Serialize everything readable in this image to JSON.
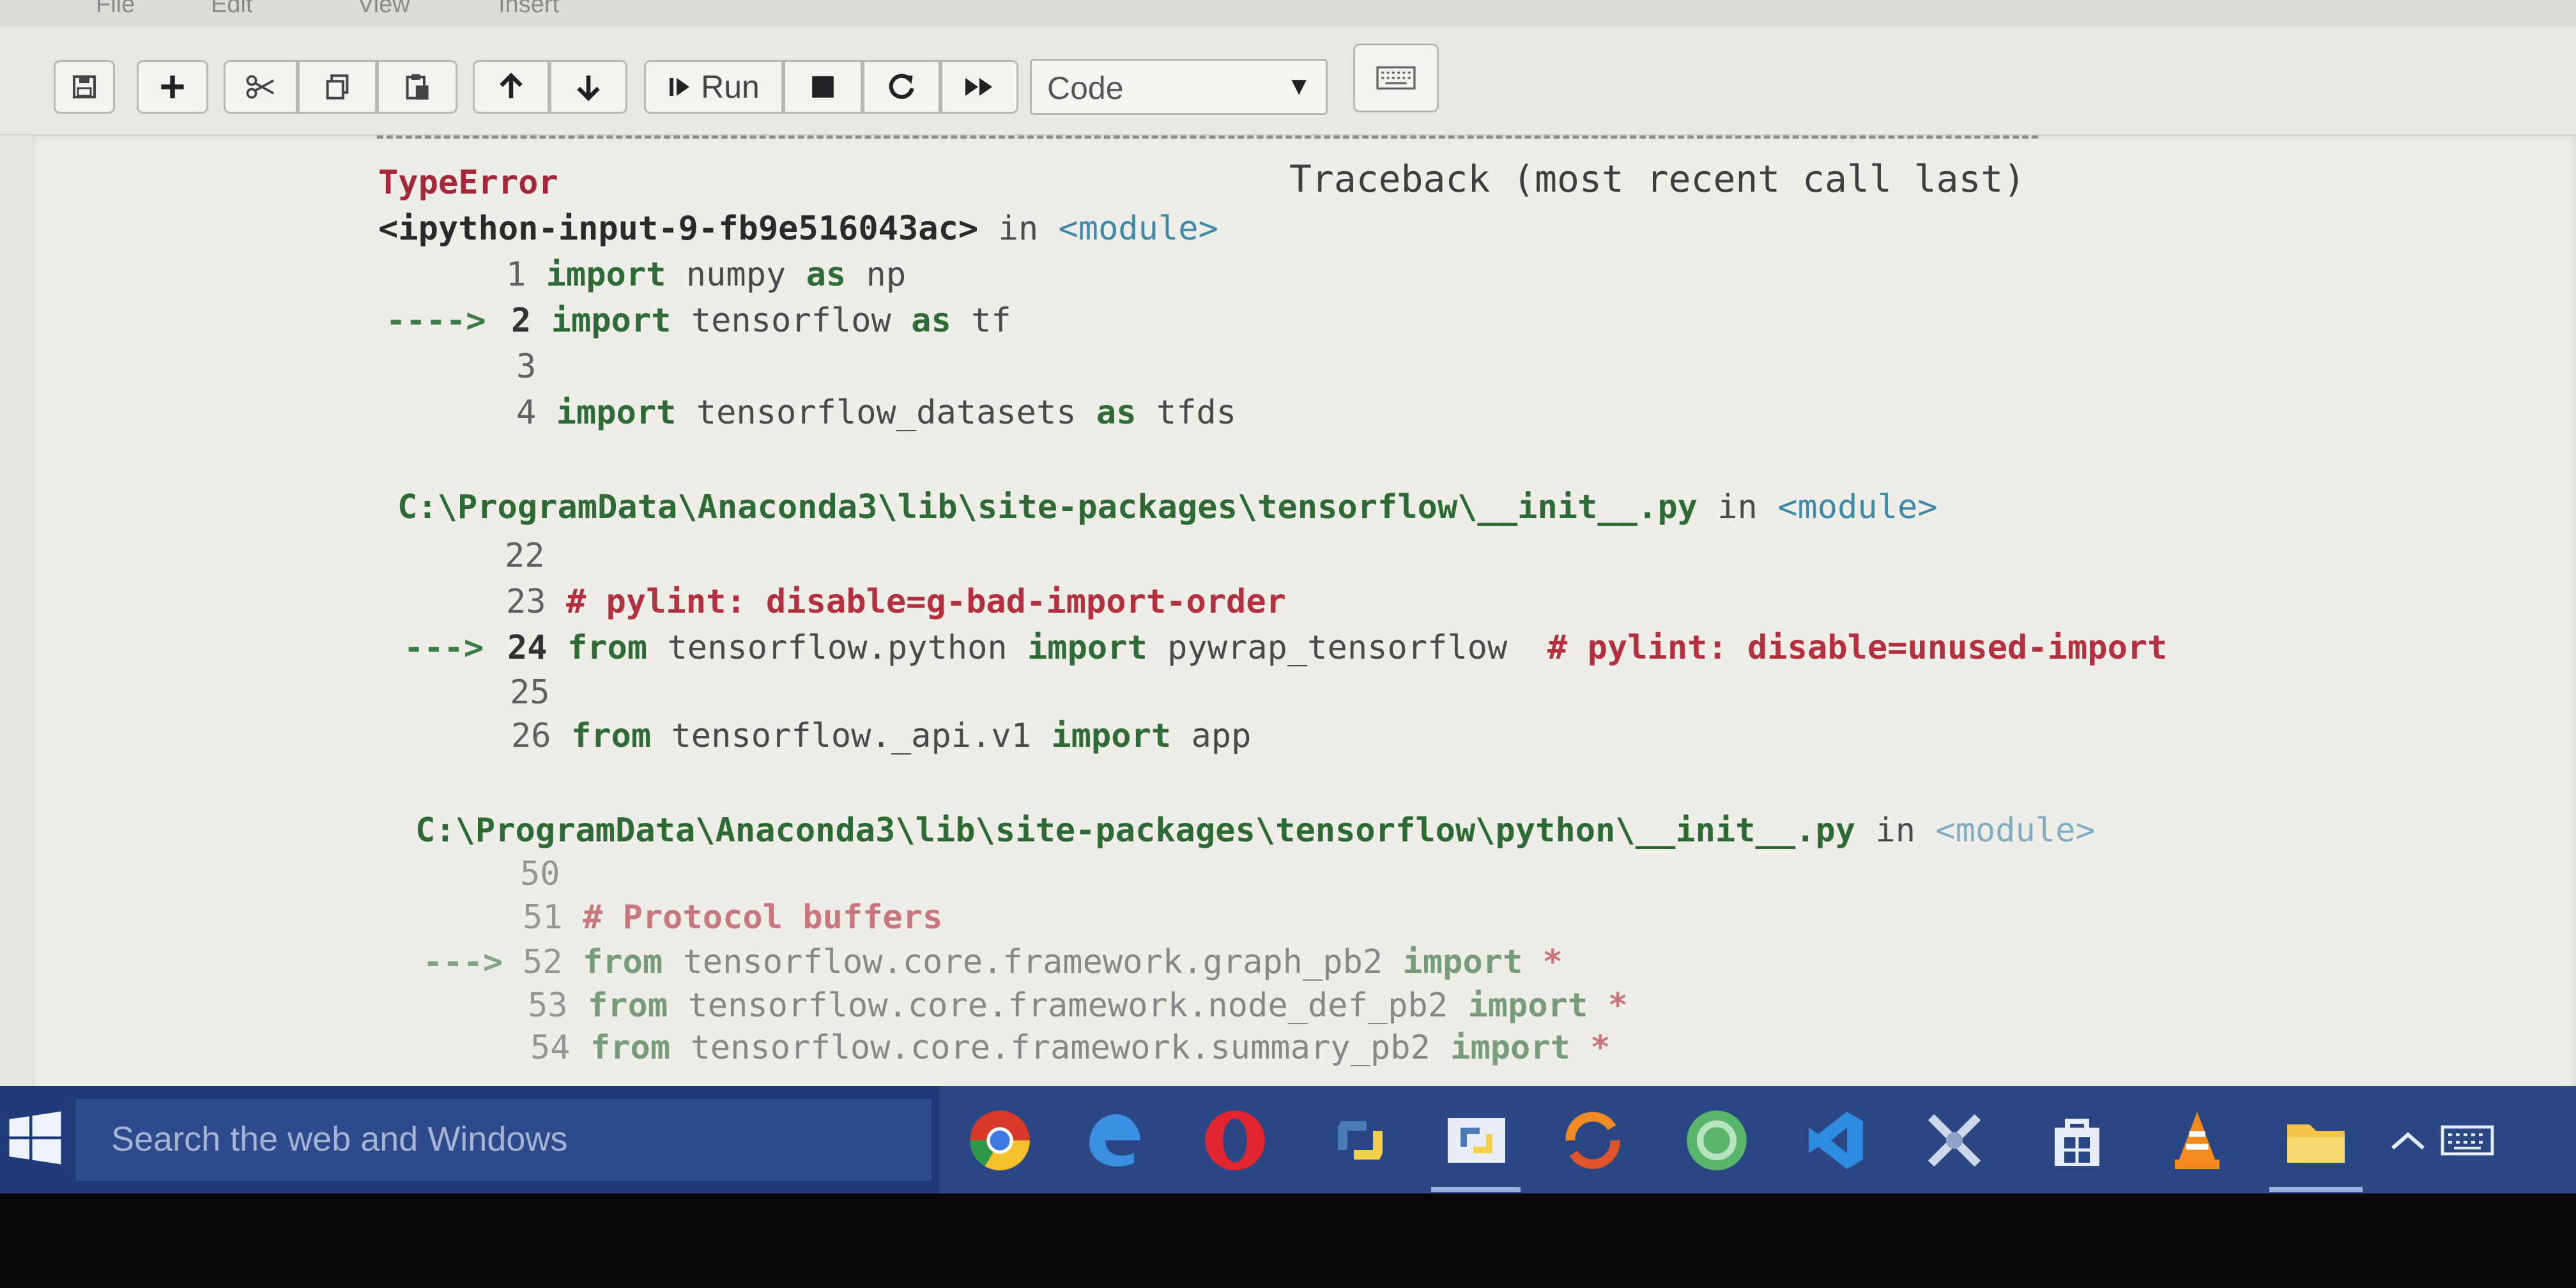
{
  "menubar": {
    "items": [
      "File",
      "Edit",
      "View",
      "Insert"
    ]
  },
  "toolbar": {
    "buttons": [
      {
        "name": "save",
        "icon": "floppy-disk-icon"
      },
      {
        "name": "insert-cell",
        "icon": "plus-icon"
      },
      {
        "name": "cut",
        "icon": "scissors-icon"
      },
      {
        "name": "copy",
        "icon": "copy-icon"
      },
      {
        "name": "paste",
        "icon": "paste-icon"
      },
      {
        "name": "move-up",
        "icon": "arrow-up-icon"
      },
      {
        "name": "move-down",
        "icon": "arrow-down-icon"
      },
      {
        "name": "run",
        "icon": "step-forward-icon"
      },
      {
        "name": "interrupt",
        "icon": "stop-icon"
      },
      {
        "name": "restart",
        "icon": "restart-icon"
      },
      {
        "name": "restart-run-all",
        "icon": "fast-forward-icon"
      },
      {
        "name": "command-palette",
        "icon": "keyboard-icon"
      }
    ],
    "run_label": "Run",
    "cell_type": "Code"
  },
  "traceback": {
    "error_type": "TypeError",
    "header_right": "Traceback (most recent call last)",
    "frame1": {
      "source": "<ipython-input-9-fb9e516043ac>",
      "in_word": "in",
      "module": "<module>",
      "l1_num": "1",
      "l1_kw1": "import",
      "l1_rest": " numpy ",
      "l1_kw2": "as",
      "l1_tail": " np",
      "arrow": "---->",
      "l2_num": "2",
      "l2_kw1": "import",
      "l2_rest": " tensorflow ",
      "l2_kw2": "as",
      "l2_tail": " tf",
      "l3_num": "3",
      "l4_num": "4",
      "l4_kw1": "import",
      "l4_rest": " tensorflow_datasets ",
      "l4_kw2": "as",
      "l4_tail": " tfds"
    },
    "frame2": {
      "path": "C:\\ProgramData\\Anaconda3\\lib\\site-packages\\tensorflow\\__init__.py",
      "in_word": "in",
      "module": "<module>",
      "l22": "22",
      "l23_num": "23",
      "l23_comment": "# pylint: disable=g-bad-import-order",
      "arrow": "--->",
      "l24_num": "24",
      "l24_kw1": "from",
      "l24_rest": " tensorflow.python ",
      "l24_kw2": "import",
      "l24_tail": " pywrap_tensorflow  ",
      "l24_comment": "# pylint: disable=unused-import",
      "l25": "25",
      "l26_num": "26",
      "l26_kw1": "from",
      "l26_rest": " tensorflow._api.v1 ",
      "l26_kw2": "import",
      "l26_tail": " app"
    },
    "frame3": {
      "path": "C:\\ProgramData\\Anaconda3\\lib\\site-packages\\tensorflow\\python\\__init__.py",
      "in_word": "in",
      "module": "<module>",
      "l50": "50",
      "l51_num": "51",
      "l51_comment": "# Protocol buffers",
      "arrow": "--->",
      "l52_num": "52",
      "l52_kw1": "from",
      "l52_rest": " tensorflow.core.framework.graph_pb2 ",
      "l52_kw2": "import",
      "l52_tail": " *",
      "l53_num": "53",
      "l53_kw1": "from",
      "l53_rest": " tensorflow.core.framework.node_def_pb2 ",
      "l53_kw2": "import",
      "l53_tail": " *",
      "l54_num": "54",
      "l54_kw1": "from",
      "l54_rest": " tensorflow.core.framework.summary_pb2 ",
      "l54_kw2": "import",
      "l54_tail": " *"
    }
  },
  "taskbar": {
    "search_placeholder": "Search the web and Windows",
    "apps": [
      {
        "name": "chrome",
        "icon": "chrome-icon"
      },
      {
        "name": "edge",
        "icon": "edge-icon"
      },
      {
        "name": "opera",
        "icon": "opera-icon"
      },
      {
        "name": "python",
        "icon": "python-icon"
      },
      {
        "name": "python-idle",
        "icon": "python-idle-icon"
      },
      {
        "name": "sync",
        "icon": "sync-app-icon"
      },
      {
        "name": "anaconda",
        "icon": "anaconda-icon"
      },
      {
        "name": "vscode",
        "icon": "vscode-icon"
      },
      {
        "name": "tools",
        "icon": "tools-icon"
      },
      {
        "name": "store",
        "icon": "store-icon"
      },
      {
        "name": "vlc",
        "icon": "vlc-icon"
      },
      {
        "name": "file-explorer",
        "icon": "folder-icon"
      }
    ],
    "tray": {
      "icons": [
        "chevron-up-icon",
        "keyboard-icon"
      ]
    }
  },
  "colors": {
    "error": "#a3283a",
    "path": "#2e6b34",
    "keyword": "#2f6b36",
    "module": "#3e88a8",
    "comment": "#b3303e",
    "taskbar": "#1f3a78"
  }
}
